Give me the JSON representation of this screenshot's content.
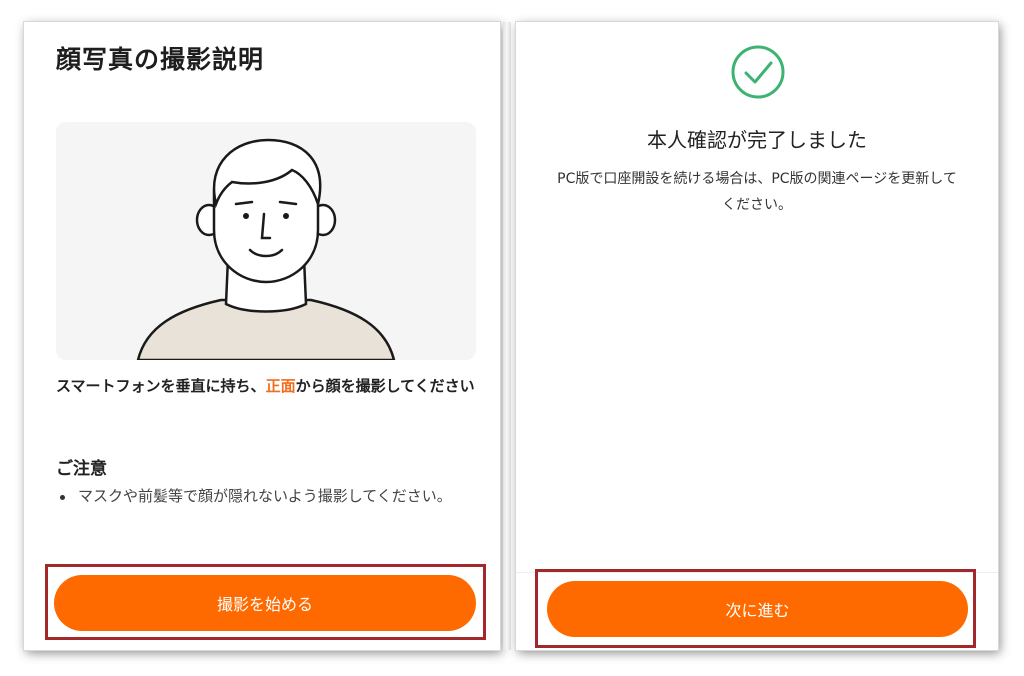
{
  "left_screen": {
    "title": "顔写真の撮影説明",
    "instruction": {
      "before": "スマートフォンを垂直に持ち、",
      "highlight": "正面",
      "after": "から顔を撮影してください"
    },
    "notice_heading": "ご注意",
    "notice_items": [
      "マスクや前髪等で顔が隠れないよう撮影してください。"
    ],
    "button_label": "撮影を始める",
    "illustration_icon": "person-portrait-illustration"
  },
  "right_screen": {
    "title": "本人確認が完了しました",
    "message": "PC版で口座開設を続ける場合は、PC版の関連ページを更新してください。",
    "button_label": "次に進む",
    "status_icon": "check-circle-icon"
  },
  "colors": {
    "accent": "#ff6a00",
    "highlight_text": "#f26d1e",
    "success": "#3cb371",
    "annotation_box": "#a3282c"
  }
}
